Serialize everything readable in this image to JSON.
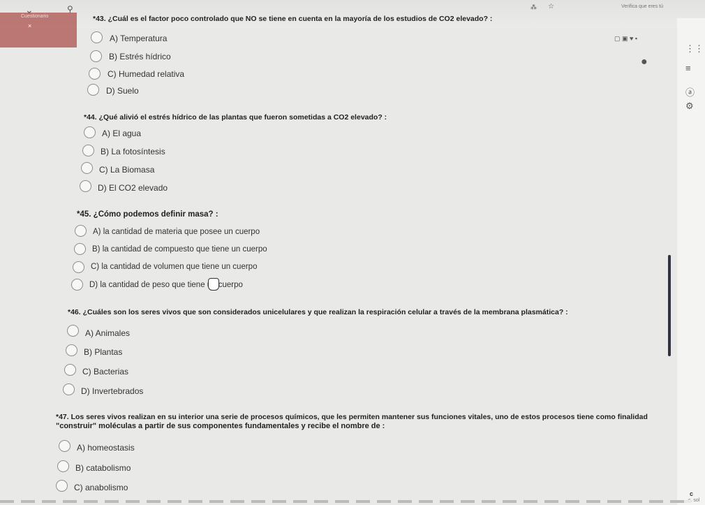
{
  "browser": {
    "tab_label": "Cuestionario",
    "tab_close": "×",
    "tab_sub": "4",
    "extension_text": "Verifica que eres tú",
    "search_icon": "search-icon",
    "star_icon": "star-icon"
  },
  "questions": [
    {
      "number": "*43.",
      "text": "¿Cuál es el factor poco controlado que NO se tiene en cuenta en la mayoría de los estudios de CO2 elevado? :",
      "options": [
        "A) Temperatura",
        "B) Estrés hídrico",
        "C) Humedad relativa",
        "D) Suelo"
      ]
    },
    {
      "number": "*44.",
      "text": "¿Qué alivió el estrés hídrico de las plantas que fueron sometidas a CO2 elevado? :",
      "options": [
        "A) El agua",
        "B) La fotosíntesis",
        "C) La Biomasa",
        "D) El CO2 elevado"
      ]
    },
    {
      "number": "*45.",
      "text": "¿Cómo podemos definir masa? :",
      "options": [
        "A) la cantidad de materia que posee un cuerpo",
        "B) la cantidad de compuesto que tiene un cuerpo",
        "C) la cantidad de volumen que tiene un cuerpo",
        "D) la cantidad de peso que tiene un cuerpo"
      ]
    },
    {
      "number": "*46.",
      "text": "¿Cuáles son los seres vivos que son considerados unicelulares y que realizan la respiración celular a través de la membrana plasmática? :",
      "options": [
        "A) Animales",
        "B) Plantas",
        "C) Bacterias",
        "D) Invertebrados"
      ]
    },
    {
      "number": "*47.",
      "text": "Los seres vivos realizan en su interior una serie de procesos químicos, que les permiten mantener sus funciones vitales, uno de estos procesos tiene como finalidad",
      "text2": "\"construir\" moléculas a partir de sus componentes fundamentales y recibe el nombre de :",
      "options": [
        "A) homeostasis",
        "B) catabolismo",
        "C) anabolismo"
      ]
    }
  ],
  "corner": {
    "c_label": "c",
    "c_sub": "c. sol"
  }
}
